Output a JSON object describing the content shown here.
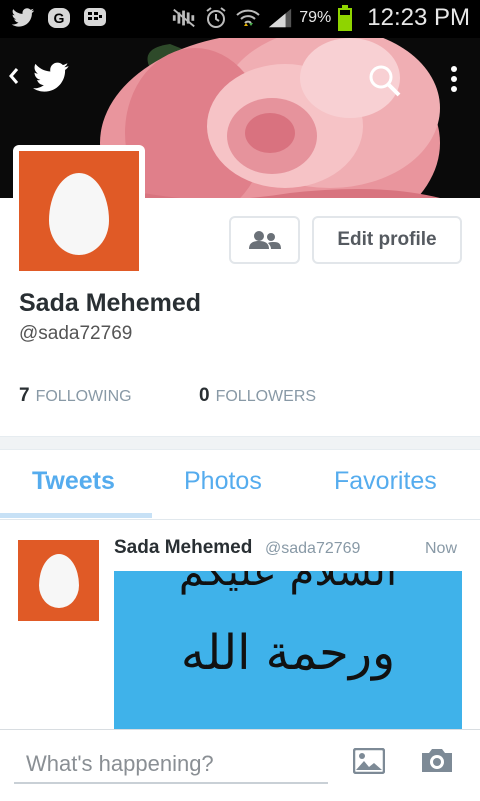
{
  "status_bar": {
    "battery_percent": "79%",
    "time": "12:23 PM",
    "icons": [
      "twitter-notification-icon",
      "gmail-icon",
      "bbm-icon",
      "mute-icon",
      "alarm-icon",
      "wifi-icon",
      "signal-icon",
      "battery-icon"
    ]
  },
  "header": {
    "back_icon": "chevron-left-icon",
    "logo_icon": "twitter-bird-icon",
    "search_icon": "search-icon",
    "menu_icon": "overflow-menu-icon"
  },
  "profile": {
    "edit_profile_label": "Edit profile",
    "name": "Sada Mehemed",
    "handle": "@sada72769",
    "following_count": "7",
    "following_label": "FOLLOWING",
    "followers_count": "0",
    "followers_label": "FOLLOWERS"
  },
  "tabs": [
    {
      "label": "Tweets",
      "active": true
    },
    {
      "label": "Photos",
      "active": false
    },
    {
      "label": "Favorites",
      "active": false
    }
  ],
  "tweet": {
    "author_name": "Sada Mehemed",
    "author_handle": "@sada72769",
    "time": "Now",
    "media_text_line1": "السلام عليكم",
    "media_text_line2": "ورحمة الله"
  },
  "composer": {
    "placeholder": "What's happening?"
  },
  "colors": {
    "accent": "#55acee",
    "avatar_orange": "#e05a26",
    "media_blue": "#3fb2ea"
  }
}
